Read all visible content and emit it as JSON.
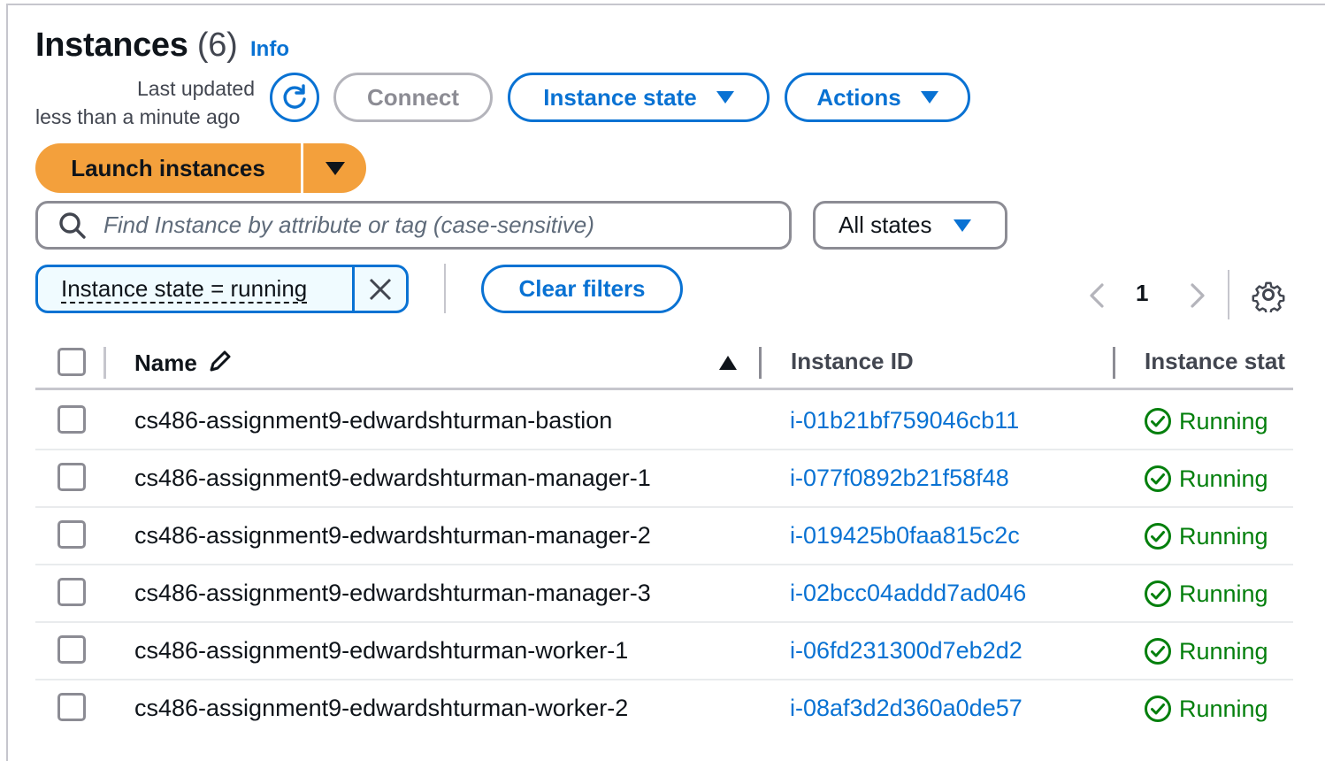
{
  "header": {
    "title": "Instances",
    "count": "(6)",
    "info_link": "Info",
    "last_updated_line1": "Last updated",
    "last_updated_line2": "less than a minute ago"
  },
  "toolbar": {
    "connect_label": "Connect",
    "instance_state_label": "Instance state",
    "actions_label": "Actions",
    "launch_label": "Launch instances"
  },
  "filters": {
    "search_placeholder": "Find Instance by attribute or tag (case-sensitive)",
    "state_select_value": "All states",
    "active_token": "Instance state = running",
    "clear_label": "Clear filters"
  },
  "pagination": {
    "current_page": "1"
  },
  "table": {
    "columns": [
      "Name",
      "Instance ID",
      "Instance stat"
    ],
    "rows": [
      {
        "name": "cs486-assignment9-edwardshturman-bastion",
        "id": "i-01b21bf759046cb11",
        "state": "Running"
      },
      {
        "name": "cs486-assignment9-edwardshturman-manager-1",
        "id": "i-077f0892b21f58f48",
        "state": "Running"
      },
      {
        "name": "cs486-assignment9-edwardshturman-manager-2",
        "id": "i-019425b0faa815c2c",
        "state": "Running"
      },
      {
        "name": "cs486-assignment9-edwardshturman-manager-3",
        "id": "i-02bcc04addd7ad046",
        "state": "Running"
      },
      {
        "name": "cs486-assignment9-edwardshturman-worker-1",
        "id": "i-06fd231300d7eb2d2",
        "state": "Running"
      },
      {
        "name": "cs486-assignment9-edwardshturman-worker-2",
        "id": "i-08af3d2d360a0de57",
        "state": "Running"
      }
    ]
  },
  "colors": {
    "accent": "#0972d3",
    "primary_button": "#f3a03c",
    "success": "#037f0c",
    "border": "#8c8c94"
  },
  "icons": [
    "refresh-icon",
    "caret-down-icon",
    "search-icon",
    "close-icon",
    "chevron-left-icon",
    "chevron-right-icon",
    "gear-icon",
    "edit-icon",
    "sort-ascending-icon",
    "status-success-icon"
  ]
}
